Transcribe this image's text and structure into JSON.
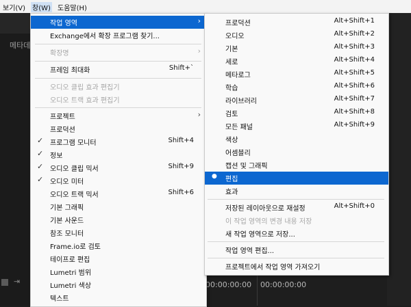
{
  "menubar": {
    "items": [
      "보기(V)",
      "창(W)",
      "도움말(H)"
    ]
  },
  "app": {
    "left_panel_title": "메타데",
    "timecode_1": "00:00:00:00",
    "timecode_2": "00:00:00:00",
    "arrows": "⇥"
  },
  "window_menu": {
    "workspaces": "작업 영역",
    "exchange": "Exchange에서 확장 프로그램 찾기...",
    "extensions": "확장명",
    "maximize": "프레임 최대화",
    "maximize_shortcut": "Shift+`",
    "audio_clip_effect_editor": "오디오 클립 효과 편집기",
    "audio_track_effect_editor": "오디오 트랙 효과 편집기",
    "project": "프로젝트",
    "production": "프로덕션",
    "program_monitor": "프로그램 모니터",
    "program_monitor_shortcut": "Shift+4",
    "info": "정보",
    "audio_clip_mixer": "오디오 클립 믹서",
    "audio_clip_mixer_shortcut": "Shift+9",
    "audio_meters": "오디오 미터",
    "audio_track_mixer": "오디오 트랙 믹서",
    "audio_track_mixer_shortcut": "Shift+6",
    "essential_graphics": "기본 그래픽",
    "essential_sound": "기본 사운드",
    "reference_monitor": "참조 모니터",
    "frameio_review": "Frame.io로 검토",
    "edit_to_tape": "테이프로 편집",
    "lumetri_scopes": "Lumetri 범위",
    "lumetri_color": "Lumetri 색상",
    "text": "텍스트",
    "check": "✓",
    "arrow": "›"
  },
  "workspace_menu": {
    "production": "프로덕션",
    "production_sc": "Alt+Shift+1",
    "audio": "오디오",
    "audio_sc": "Alt+Shift+2",
    "essentials": "기본",
    "essentials_sc": "Alt+Shift+3",
    "vertical": "세로",
    "vertical_sc": "Alt+Shift+4",
    "metalogging": "메타로그",
    "metalogging_sc": "Alt+Shift+5",
    "learning": "학습",
    "learning_sc": "Alt+Shift+6",
    "libraries": "라이브러리",
    "libraries_sc": "Alt+Shift+7",
    "review": "검토",
    "review_sc": "Alt+Shift+8",
    "all_panels": "모든 패널",
    "all_panels_sc": "Alt+Shift+9",
    "color": "색상",
    "assembly": "어셈블리",
    "captions_graphics": "캡션 및 그래픽",
    "editing": "편집",
    "editing_marker": "●",
    "effects": "효과",
    "reset_saved": "저장된 레이아웃으로 재설정",
    "reset_saved_sc": "Alt+Shift+0",
    "save_changes": "이 작업 영역의 변경 내용 저장",
    "save_as_new": "새 작업 영역으로 저장...",
    "edit_workspaces": "작업 영역 편집...",
    "import_from_project": "프로젝트에서 작업 영역 가져오기"
  }
}
